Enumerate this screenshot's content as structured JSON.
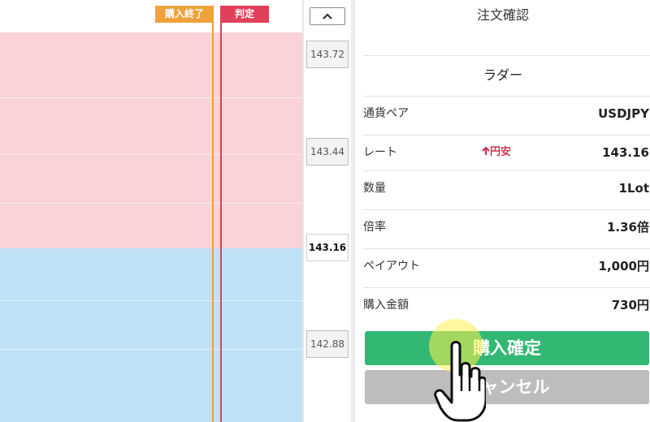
{
  "chart": {
    "tag_buy_end": "購入終了",
    "tag_judgement": "判定",
    "scroll_up_icon": "chevron-up",
    "prices": [
      "143.72",
      "143.44",
      "143.16",
      "142.88"
    ],
    "current_price": "143.16",
    "colors": {
      "upper_zone": "#f9d3d5",
      "lower_zone": "#bfe2f8",
      "buy_end_line": "#f0a13b",
      "judgement_line": "#e0405a"
    }
  },
  "panel": {
    "title": "注文確認",
    "subtitle": "ラダー",
    "rows": [
      {
        "label": "通貨ペア",
        "value": "USDJPY"
      },
      {
        "label": "レート",
        "trend": "円安",
        "value": "143.16"
      },
      {
        "label": "数量",
        "value": "1Lot"
      },
      {
        "label": "倍率",
        "value": "1.36倍"
      },
      {
        "label": "ペイアウト",
        "value": "1,000円"
      },
      {
        "label": "購入金額",
        "value": "730円"
      }
    ],
    "confirm_label": "購入確定",
    "cancel_label": "キャンセル",
    "colors": {
      "confirm": "#33b873",
      "cancel": "#bdbdbd",
      "trend": "#d23350"
    }
  }
}
